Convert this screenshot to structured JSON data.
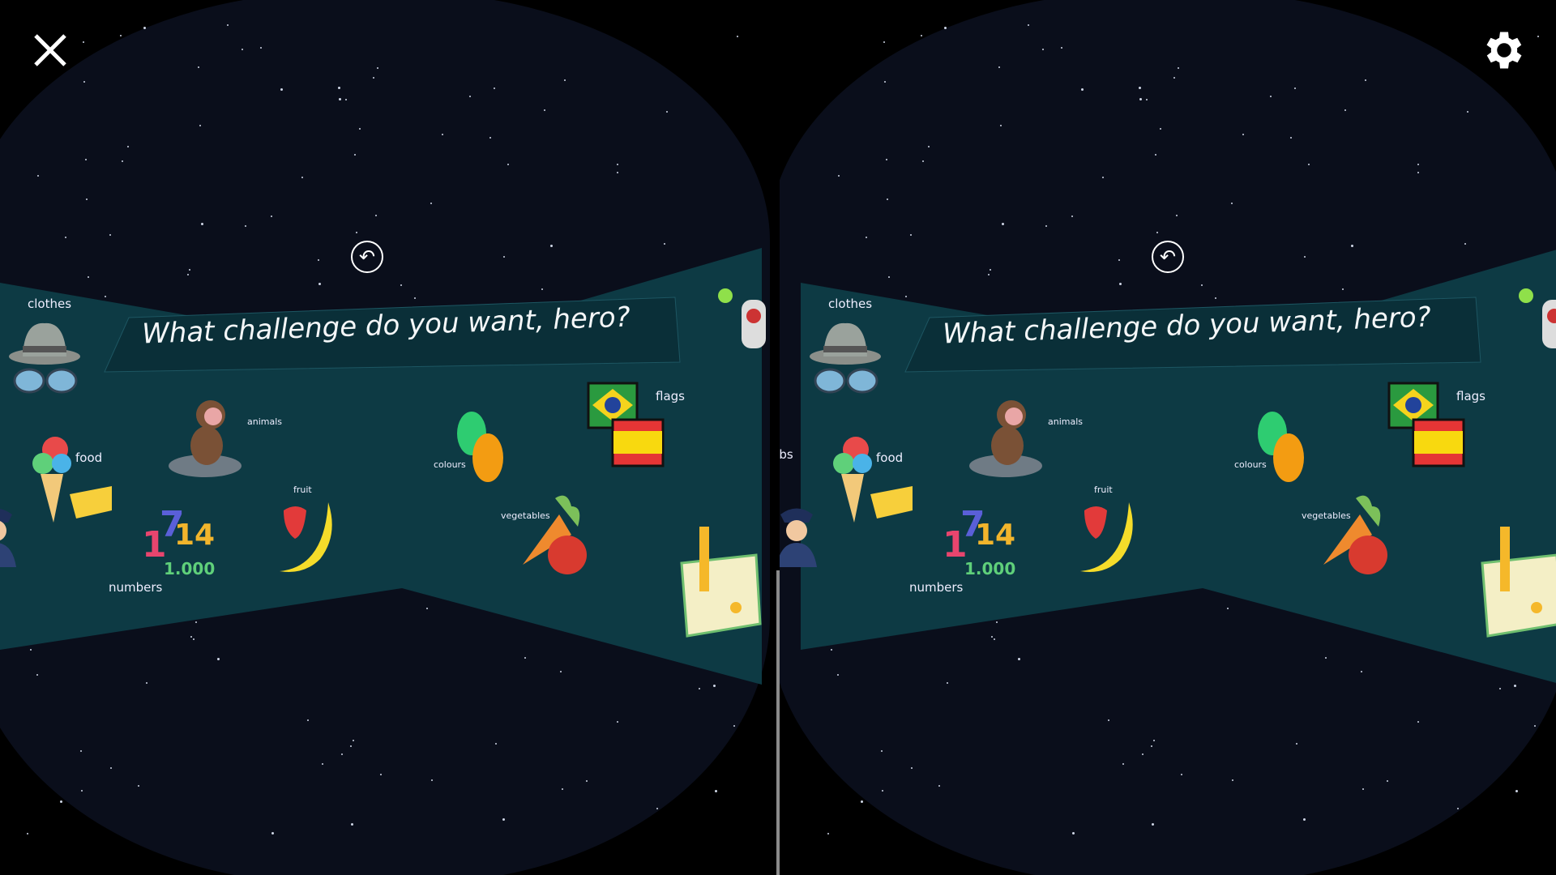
{
  "toolbar": {
    "close_icon": "close-icon",
    "settings_icon": "gear-icon"
  },
  "scene": {
    "title": "What challenge do you want, hero?",
    "back_icon": "back-arrow-icon",
    "back_glyph": "↶",
    "categories": {
      "clothes": "clothes",
      "food": "food",
      "animals": "animals",
      "numbers": "numbers",
      "fruit": "fruit",
      "colours": "colours",
      "flags": "flags",
      "vegetables": "vegetables",
      "jobs": "jobs"
    },
    "numbers_art": {
      "a": "1",
      "b": "7",
      "c": "14",
      "d": "1.000"
    }
  },
  "colors": {
    "panel": "#0d3a44",
    "banner": "#0a2f38",
    "space": "#0a0e1b"
  }
}
